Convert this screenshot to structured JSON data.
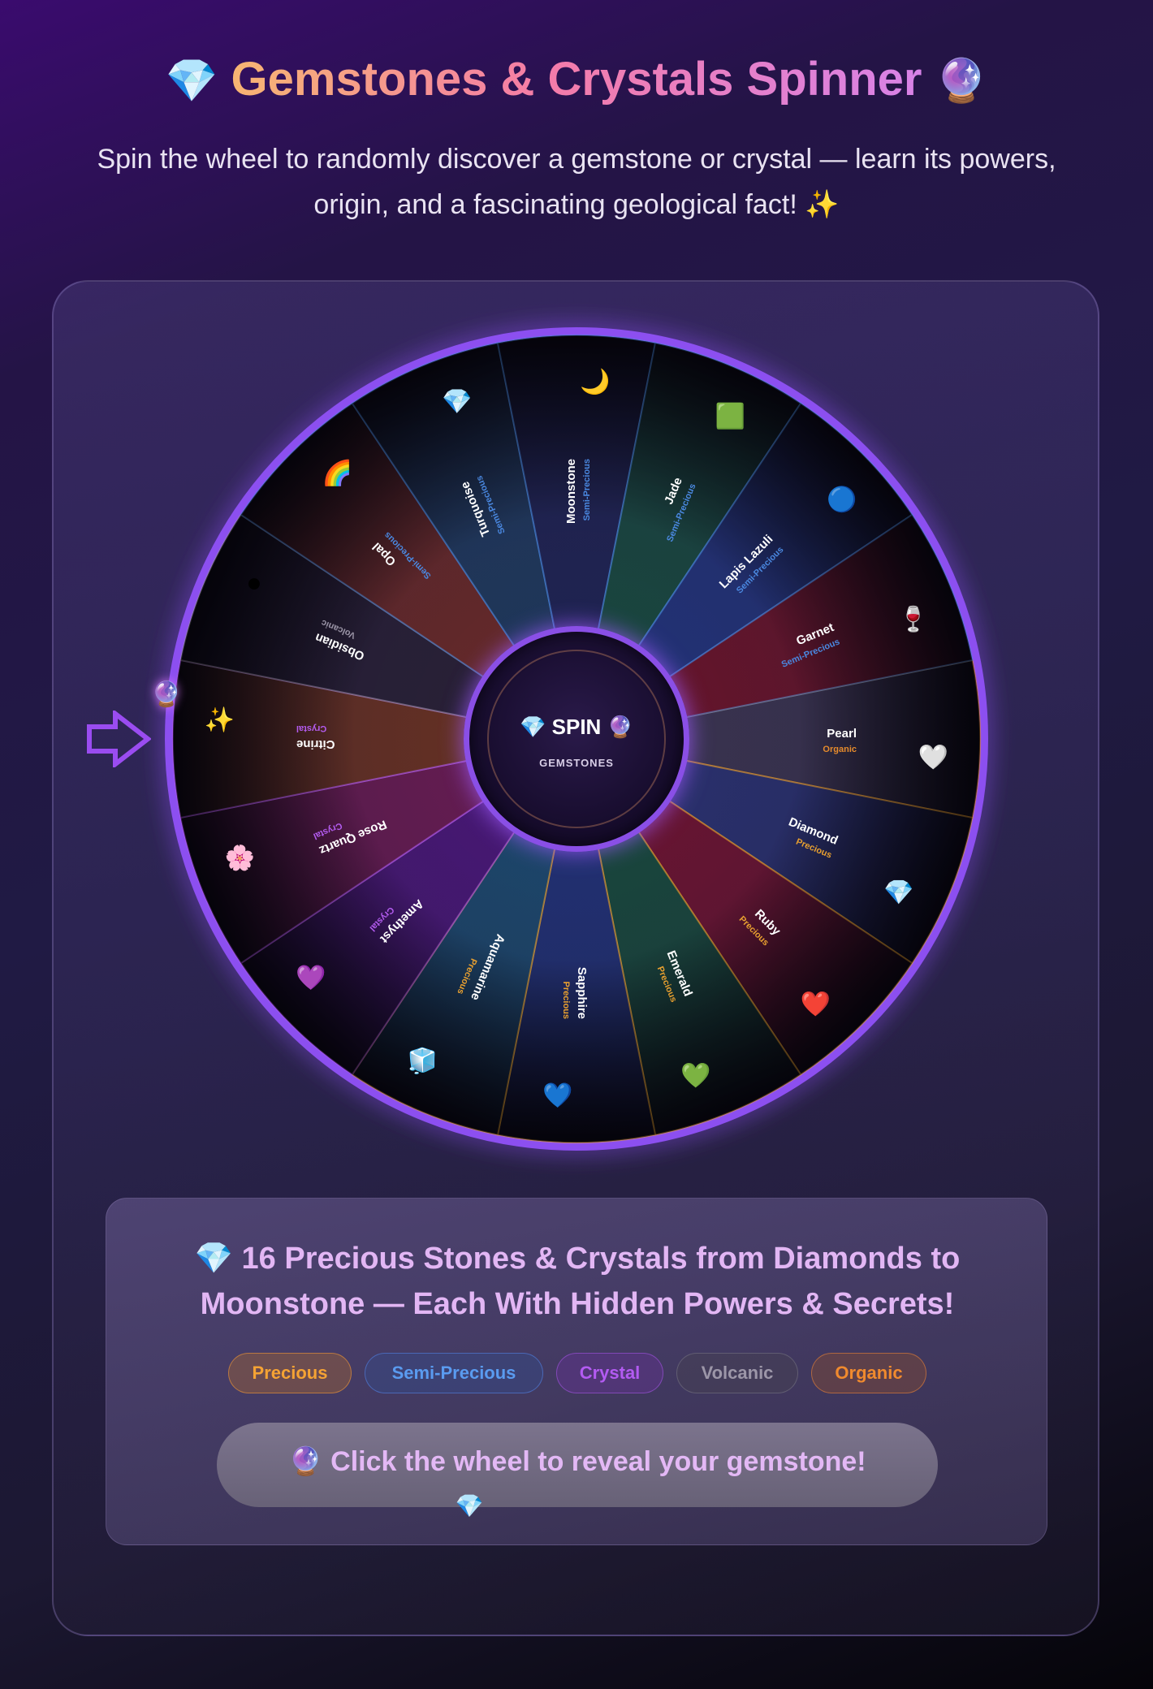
{
  "header": {
    "title_icon_left": "💎",
    "title": "Gemstones & Crystals Spinner",
    "title_icon_right": "🔮",
    "subtitle": "Spin the wheel to randomly discover a gemstone or crystal — learn its powers, origin, and a fascinating geological fact! ✨"
  },
  "wheel": {
    "hub_label": "💎 SPIN 🔮",
    "hub_sub": "GEMSTONES",
    "pointer_icon": "arrow-right-icon",
    "pointer_ball": "🔮",
    "segments": [
      {
        "name": "Pearl",
        "category": "Organic",
        "emoji": "🤍",
        "color": "#3b3550",
        "cat_color": "#e68b2c"
      },
      {
        "name": "Diamond",
        "category": "Precious",
        "emoji": "💎",
        "color": "#2a3270",
        "cat_color": "#e8a030"
      },
      {
        "name": "Ruby",
        "category": "Precious",
        "emoji": "❤️",
        "color": "#6e1430",
        "cat_color": "#e8a030"
      },
      {
        "name": "Emerald",
        "category": "Precious",
        "emoji": "💚",
        "color": "#184a3c",
        "cat_color": "#e8a030"
      },
      {
        "name": "Sapphire",
        "category": "Precious",
        "emoji": "💙",
        "color": "#213276",
        "cat_color": "#e8a030"
      },
      {
        "name": "Aquamarine",
        "category": "Precious",
        "emoji": "🧊",
        "color": "#1c4a6e",
        "cat_color": "#e8a030"
      },
      {
        "name": "Amethyst",
        "category": "Crystal",
        "emoji": "💜",
        "color": "#4a1878",
        "cat_color": "#b45cf0"
      },
      {
        "name": "Rose Quartz",
        "category": "Crystal",
        "emoji": "🌸",
        "color": "#6a1c52",
        "cat_color": "#b45cf0"
      },
      {
        "name": "Citrine",
        "category": "Crystal",
        "emoji": "✨",
        "color": "#6a3220",
        "cat_color": "#b45cf0"
      },
      {
        "name": "Obsidian",
        "category": "Volcanic",
        "emoji": "⚫",
        "color": "#282034",
        "cat_color": "#9a94a6"
      },
      {
        "name": "Opal",
        "category": "Semi-Precious",
        "emoji": "🌈",
        "color": "#6a2a26",
        "cat_color": "#4a88e0"
      },
      {
        "name": "Turquoise",
        "category": "Semi-Precious",
        "emoji": "💎",
        "color": "#1e3a5c",
        "cat_color": "#4a88e0"
      },
      {
        "name": "Moonstone",
        "category": "Semi-Precious",
        "emoji": "🌙",
        "color": "#1e2452",
        "cat_color": "#4a88e0"
      },
      {
        "name": "Jade",
        "category": "Semi-Precious",
        "emoji": "🟩",
        "color": "#184a3e",
        "cat_color": "#4a88e0"
      },
      {
        "name": "Lapis Lazuli",
        "category": "Semi-Precious",
        "emoji": "🔵",
        "color": "#22347a",
        "cat_color": "#4a88e0"
      },
      {
        "name": "Garnet",
        "category": "Semi-Precious",
        "emoji": "🍷",
        "color": "#6a1428",
        "cat_color": "#4a88e0"
      }
    ]
  },
  "info": {
    "title": "💎 16 Precious Stones & Crystals from Diamonds to Moonstone — Each With Hidden Powers & Secrets!",
    "tags": {
      "precious": "Precious",
      "semi_precious": "Semi-Precious",
      "crystal": "Crystal",
      "volcanic": "Volcanic",
      "organic": "Organic"
    },
    "cta": "🔮 Click the wheel to reveal your gemstone!",
    "cta_gem": "💎"
  }
}
